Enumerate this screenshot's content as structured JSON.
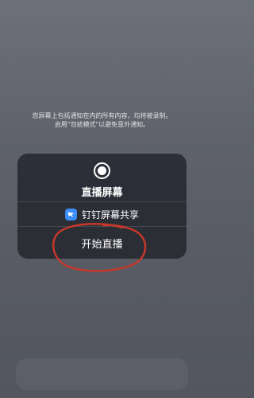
{
  "notice": {
    "line1": "您屏幕上包括通知在内的所有内容，均将被录制。",
    "line2": "启用\"勿扰模式\"以避免意外通知。"
  },
  "sheet": {
    "title": "直播屏幕",
    "app_label": "钉钉屏幕共享",
    "start_label": "开始直播"
  },
  "colors": {
    "annotation": "#c8382a",
    "app_icon": "#3a8ef6"
  },
  "icons": {
    "record": "record-icon",
    "app": "dingtalk-icon"
  }
}
